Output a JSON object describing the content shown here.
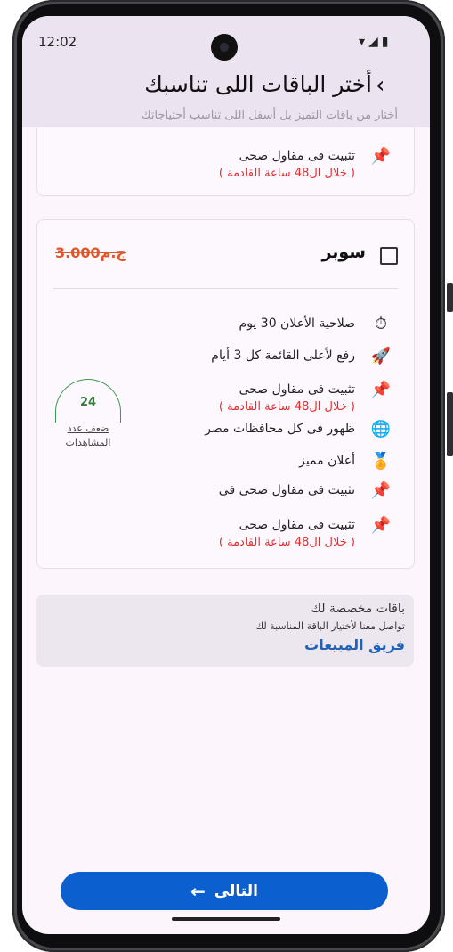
{
  "status": {
    "time": "12:02",
    "icons": "▾◢▮"
  },
  "header": {
    "title": "أختر الباقات اللى تناسبك",
    "subtitle": "أختار من باقات التميز بل أسفل اللى تناسب أحتياجاتك",
    "back_icon": "‹"
  },
  "prev_card": {
    "row": {
      "icon": "📌",
      "text": "تثبيت فى مقاول صحى",
      "note": "( خلال ال48 ساعة القادمة )"
    }
  },
  "plan": {
    "name": "سوبر",
    "price": "3.000ج.م",
    "features": [
      {
        "icon": "⏱",
        "text": "صلاحية الأعلان 30 يوم"
      },
      {
        "icon": "🚀",
        "text": "رفع لأعلى القائمة كل 3 أيام"
      },
      {
        "icon": "📌",
        "text": "تثبيت فى مقاول صحى",
        "note": "( خلال ال48 ساعة القادمة )"
      },
      {
        "icon": "🌐",
        "text": "ظهور فى كل محافظات مصر"
      },
      {
        "icon": "🏅",
        "text": "أعلان مميز"
      },
      {
        "icon": "📌",
        "text": "تثبيت فى مقاول صحى فى"
      },
      {
        "icon": "📌",
        "text": "تثبيت فى مقاول صحى",
        "note": "( خلال ال48 ساعة القادمة )"
      }
    ],
    "gauge": {
      "value": "24",
      "label": "ضعف عدد المشاهدات"
    }
  },
  "custom": {
    "title": "باقات مخصصة لك",
    "subtitle": "تواصل معنا لأختيار الباقة المناسبة لك",
    "link": "فريق المبيعات"
  },
  "footer": {
    "next_label": "التالى",
    "next_icon": "←"
  }
}
